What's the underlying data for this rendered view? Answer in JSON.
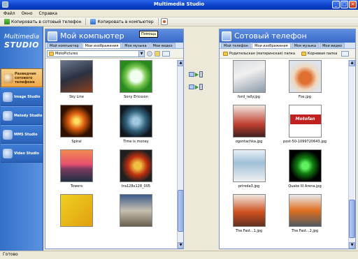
{
  "window": {
    "title": "Multimedia Studio"
  },
  "menu": [
    "Файл",
    "Окно",
    "Справка"
  ],
  "toolbar": {
    "copy_to_phone": "Копировать в сотовый телефон",
    "copy_to_pc": "Копировать в компьютер"
  },
  "sidebar": {
    "logo_line1": "Multimedia",
    "logo_line2": "STUDIO",
    "items": [
      {
        "label": "Разведчик сотового телефона"
      },
      {
        "label": "Image Studio"
      },
      {
        "label": "Melody Studio"
      },
      {
        "label": "MMS Studio"
      },
      {
        "label": "Video Studio"
      }
    ]
  },
  "left_panel": {
    "title": "Мой компьютер",
    "tabs": [
      "Мой компьютер",
      "Мои изображения",
      "Моя музыка",
      "Мои видео"
    ],
    "path": "MotoPictures",
    "tooltip": "Помощь",
    "files": [
      "Sky Line",
      "Sony Ericsson",
      "Spiral",
      "Time is money",
      "Towers",
      "tra128x128_005",
      "",
      ""
    ]
  },
  "right_panel": {
    "title": "Сотовый телефон",
    "tabs": [
      "Мой телефон",
      "Мои изображения",
      "Моя музыка",
      "Мои видео"
    ],
    "parent_folder": "Родительская (материнская) папка",
    "root_folder": "Корневая папка",
    "files": [
      "ford_rally.jpg",
      "Fox.jpg",
      "ogontachka.jpg",
      "post-50-1099720643.jpg",
      "prirodа3.jpg",
      "Quake III Arena.jpg",
      "The Fast...1.jpg",
      "The Fast...2.jpg"
    ],
    "motofan_text": "Motofan"
  },
  "status": {
    "text": "Готово"
  },
  "colors": {
    "title_bar": "#0a3fc8",
    "sidebar": "#3470c8",
    "active_nav": "#f0a848",
    "panel_head": "#3a6ac8"
  }
}
